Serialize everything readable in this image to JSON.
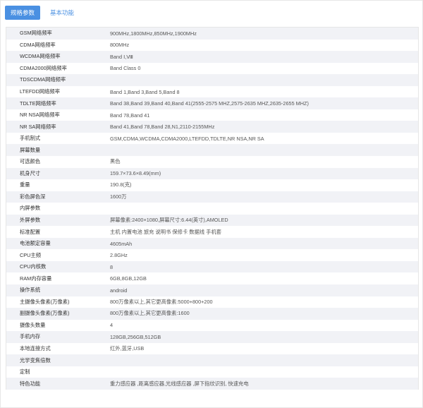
{
  "tabs": [
    {
      "label": "规格参数",
      "active": true
    },
    {
      "label": "基本功能",
      "active": false
    }
  ],
  "specs": [
    {
      "key": "GSM网络频率",
      "value": "900MHz,1800MHz,850MHz,1900MHz"
    },
    {
      "key": "CDMA网络频率",
      "value": "800MHz"
    },
    {
      "key": "WCDMA网络频率",
      "value": "Band Ⅰ,Ⅷ"
    },
    {
      "key": "CDMA2000网络频率",
      "value": "Band Class 0"
    },
    {
      "key": "TDSCDMA网络频率",
      "value": ""
    },
    {
      "key": "LTEFDD网络频率",
      "value": "Band 1,Band 3,Band 5,Band 8"
    },
    {
      "key": "TDLTE网络频率",
      "value": "Band 38,Band 39,Band 40,Band 41(2555-2575 MHZ,2575-2635 MHZ,2635-2655 MHZ)"
    },
    {
      "key": "NR NSA网络频率",
      "value": "Band 78,Band 41"
    },
    {
      "key": "NR SA网络频率",
      "value": "Band 41,Band 78,Band 28,N1,2110-2155MHz"
    },
    {
      "key": "手机制式",
      "value": "GSM,CDMA,WCDMA,CDMA2000,LTEFDD,TDLTE,NR NSA,NR SA"
    },
    {
      "key": "屏幕数量",
      "value": ""
    },
    {
      "key": "可选颜色",
      "value": "黑色"
    },
    {
      "key": "机身尺寸",
      "value": "159.7×73.6×8.49(mm)"
    },
    {
      "key": "重量",
      "value": "190.8(克)"
    },
    {
      "key": "彩色屏色深",
      "value": "1600万"
    },
    {
      "key": "内屏参数",
      "value": ""
    },
    {
      "key": "外屏参数",
      "value": "屏幕像素:2400×1080,屏幕尺寸:6.44(英寸),AMOLED"
    },
    {
      "key": "标准配置",
      "value": "主机 内置电池 旅充 说明书 保修卡 数据线 手机套"
    },
    {
      "key": "电池额定容量",
      "value": "4605mAh"
    },
    {
      "key": "CPU主频",
      "value": "2.8GHz"
    },
    {
      "key": "CPU内核数",
      "value": "8"
    },
    {
      "key": "RAM内存容量",
      "value": "6GB,8GB,12GB"
    },
    {
      "key": "操作系统",
      "value": "android"
    },
    {
      "key": "主摄像头像素(万像素)",
      "value": "800万像素以上,其它更高像素:5000+800+200"
    },
    {
      "key": "副摄像头像素(万像素)",
      "value": "800万像素以上,其它更高像素:1600"
    },
    {
      "key": "摄像头数量",
      "value": "4"
    },
    {
      "key": "手机内存",
      "value": "128GB,256GB,512GB"
    },
    {
      "key": "本地连接方式",
      "value": "红外,蓝牙,USB"
    },
    {
      "key": "光学变焦倍数",
      "value": ""
    },
    {
      "key": "定制",
      "value": ""
    },
    {
      "key": "特色功能",
      "value": "重力感应器 ,距离感应器,光线感应器 ,屏下指纹识别, 快速充电"
    }
  ]
}
